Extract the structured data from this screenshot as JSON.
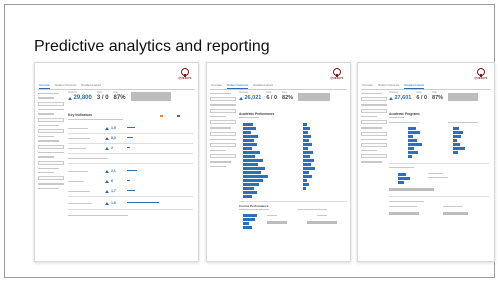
{
  "slide": {
    "title": "Predictive analytics and reporting"
  },
  "logo": {
    "text": "QUEEN'S"
  },
  "screens": [
    {
      "tabs": [
        "Overview",
        "Student Outcomes",
        "Detailed Analysis"
      ],
      "active_tab": 0,
      "kpis": [
        {
          "label": "Students",
          "value": "29,800",
          "trend": "up"
        },
        {
          "label": "Ratio",
          "value": "3 / 0"
        },
        {
          "label": "Rate",
          "value": "87%"
        }
      ],
      "section": "Key Indicators"
    },
    {
      "tabs": [
        "Overview",
        "Student Outcomes",
        "Detailed Analysis"
      ],
      "active_tab": 1,
      "kpis": [
        {
          "label": "Students",
          "value": "26,021",
          "trend": "up"
        },
        {
          "label": "Ratio",
          "value": "6 / 0"
        },
        {
          "label": "Rate",
          "value": "82%"
        }
      ],
      "section": "Academic Performance",
      "section2": "Course Performance"
    },
    {
      "tabs": [
        "Overview",
        "Student Outcomes",
        "Detailed Analysis"
      ],
      "active_tab": 2,
      "kpis": [
        {
          "label": "Students",
          "value": "27,601",
          "trend": "up"
        },
        {
          "label": "Ratio",
          "value": "6 / 0"
        },
        {
          "label": "Rate",
          "value": "87%"
        }
      ],
      "section": "Academic Programs"
    }
  ],
  "colors": {
    "accent": "#2a6db3",
    "bar": "#2e6fb7",
    "logo": "#7a1818",
    "legend_orange": "#e8873a"
  }
}
